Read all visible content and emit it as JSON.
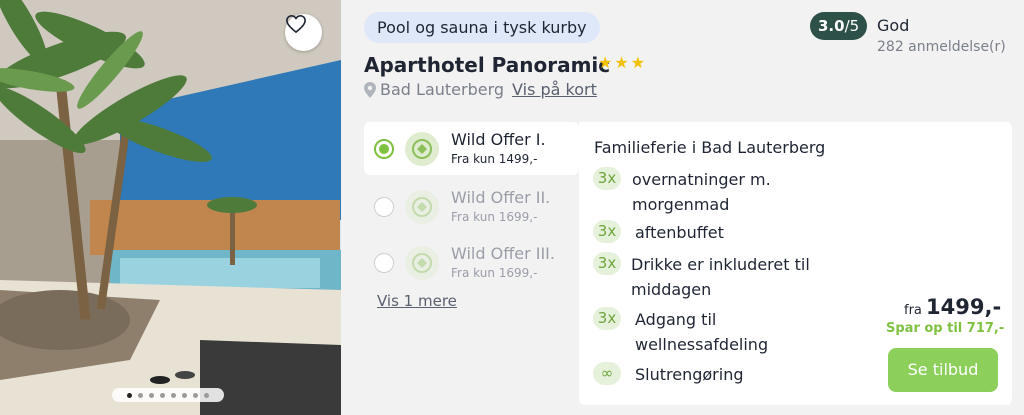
{
  "photo": {
    "favorite_icon": "heart-outline-icon",
    "slides_total": 8,
    "active_slide": 1
  },
  "hotel": {
    "tag": "Pool og sauna i tysk kurby",
    "name": "Aparthotel Panoramic",
    "stars": 3,
    "location": "Bad Lauterberg",
    "map_link": "Vis på kort"
  },
  "rating": {
    "score": "3.0",
    "scale": "/5",
    "word": "God",
    "reviews": "282 anmeldelse(r)"
  },
  "offers": [
    {
      "title": "Wild Offer I.",
      "price": "Fra kun 1499,-",
      "selected": true
    },
    {
      "title": "Wild Offer II.",
      "price": "Fra kun 1699,-",
      "selected": false
    },
    {
      "title": "Wild Offer III.",
      "price": "Fra kun 1699,-",
      "selected": false
    }
  ],
  "show_more": "Vis 1 mere",
  "details": {
    "title": "Familieferie i Bad Lauterberg",
    "features": [
      {
        "qty": "3x",
        "text": "overnatninger m. morgenmad"
      },
      {
        "qty": "3x",
        "text": "aftenbuffet"
      },
      {
        "qty": "3x",
        "text": "Drikke er inkluderet til middagen"
      },
      {
        "qty": "3x",
        "text": "Adgang til wellnessafdeling"
      },
      {
        "qty": "∞",
        "text": "Slutrengøring"
      }
    ],
    "price_prefix": "fra",
    "price": "1499,-",
    "savings": "Spar op til 717,-",
    "cta": "Se tilbud"
  },
  "colors": {
    "accent_green": "#8ccf5a",
    "rating_badge": "#2d5148",
    "tag_background": "#dfe8f8",
    "star": "#f2c200"
  }
}
